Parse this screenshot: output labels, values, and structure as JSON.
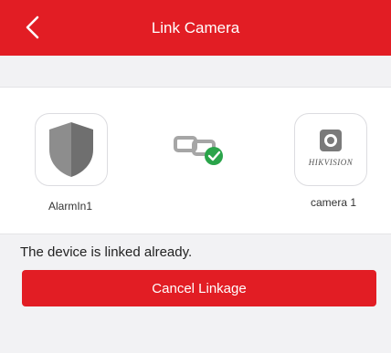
{
  "header": {
    "title": "Link Camera",
    "back_icon": "chevron-left-icon",
    "bg_color": "#e21d24"
  },
  "devices": {
    "alarm": {
      "label": "AlarmIn1",
      "icon": "shield-icon"
    },
    "link_status_icon": "linked-check-icon",
    "camera": {
      "label": "camera 1",
      "brand_text": "HIKVISION",
      "icon": "camera-icon"
    }
  },
  "status": {
    "message": "The device is linked already."
  },
  "actions": {
    "cancel_label": "Cancel Linkage"
  }
}
